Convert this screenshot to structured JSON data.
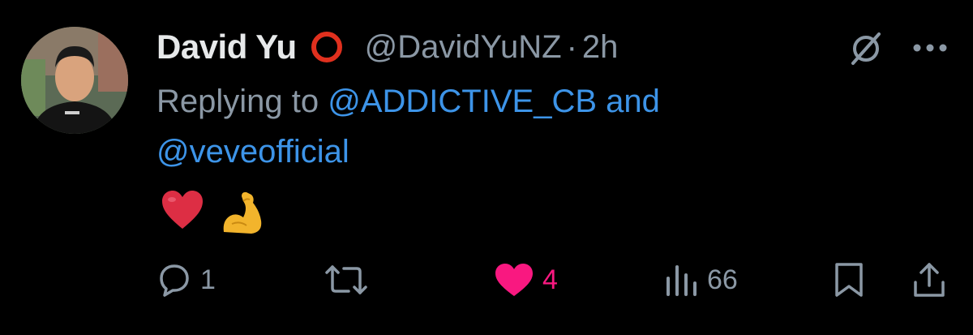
{
  "tweet": {
    "display_name": "David Yu",
    "handle": "@DavidYuNZ",
    "separator": "·",
    "time": "2h",
    "replying_prefix": "Replying to",
    "mention_1": "@ADDICTIVE_CB",
    "and_word": "and",
    "mention_2": "@veveofficial",
    "body_emojis": [
      "heart-emoji",
      "flexed-biceps-emoji"
    ]
  },
  "actions": {
    "reply_count": "1",
    "retweet_count": "",
    "like_count": "4",
    "views_count": "66"
  },
  "colors": {
    "background": "#000000",
    "text": "#e7e9ea",
    "muted": "#8b98a5",
    "link": "#3d94e8",
    "like": "#f91880",
    "badge": "#e0301e"
  },
  "icons": [
    "grok-icon",
    "more-icon",
    "reply-icon",
    "retweet-icon",
    "heart-icon",
    "views-icon",
    "bookmark-icon",
    "share-icon"
  ]
}
